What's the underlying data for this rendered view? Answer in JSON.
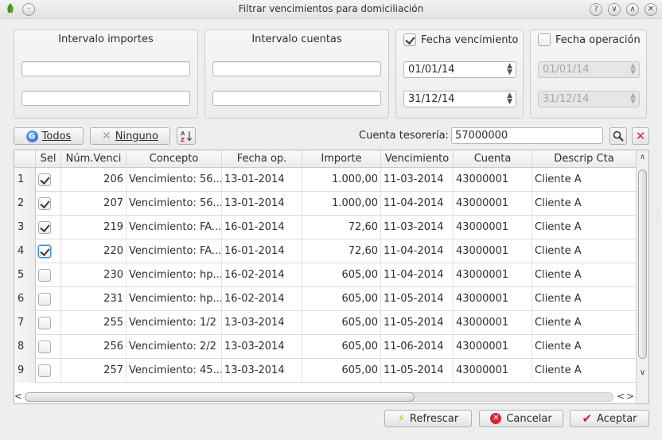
{
  "window": {
    "title": "Filtrar vencimientos para domiciliación",
    "buttons": [
      "?",
      "∨",
      "∧",
      "✕"
    ]
  },
  "filters": {
    "importes": {
      "title": "Intervalo importes",
      "from": "",
      "to": ""
    },
    "cuentas": {
      "title": "Intervalo cuentas",
      "from": "",
      "to": ""
    },
    "fecha_vencimiento": {
      "label": "Fecha vencimiento",
      "checked": true,
      "from": "01/01/14",
      "to": "31/12/14"
    },
    "fecha_operacion": {
      "label": "Fecha operación",
      "checked": false,
      "from": "01/01/14",
      "to": "31/12/14"
    }
  },
  "toolbar": {
    "todos_label": "Todos",
    "ninguno_label": "Ninguno",
    "cuenta_label": "Cuenta tesorería:",
    "cuenta_value": "57000000"
  },
  "table": {
    "columns": [
      "Sel",
      "Núm.Venci",
      "Concepto",
      "Fecha op.",
      "Importe",
      "Vencimiento",
      "Cuenta",
      "Descrip Cta"
    ],
    "rows": [
      {
        "n": "1",
        "sel": true,
        "num": "206",
        "concepto": "Vencimiento: 56...",
        "fecha": "13-01-2014",
        "importe": "1.000,00",
        "venc": "11-03-2014",
        "cuenta": "43000001",
        "desc": "Cliente A"
      },
      {
        "n": "2",
        "sel": true,
        "num": "207",
        "concepto": "Vencimiento: 56...",
        "fecha": "13-01-2014",
        "importe": "1.000,00",
        "venc": "11-04-2014",
        "cuenta": "43000001",
        "desc": "Cliente A"
      },
      {
        "n": "3",
        "sel": true,
        "num": "219",
        "concepto": "Vencimiento: FA...",
        "fecha": "16-01-2014",
        "importe": "72,60",
        "venc": "11-03-2014",
        "cuenta": "43000001",
        "desc": "Cliente A"
      },
      {
        "n": "4",
        "sel": true,
        "num": "220",
        "concepto": "Vencimiento: FA...",
        "fecha": "16-01-2014",
        "importe": "72,60",
        "venc": "11-04-2014",
        "cuenta": "43000001",
        "desc": "Cliente A"
      },
      {
        "n": "5",
        "sel": false,
        "num": "230",
        "concepto": "Vencimiento: hp...",
        "fecha": "16-02-2014",
        "importe": "605,00",
        "venc": "11-04-2014",
        "cuenta": "43000001",
        "desc": "Cliente A"
      },
      {
        "n": "6",
        "sel": false,
        "num": "231",
        "concepto": "Vencimiento: hp...",
        "fecha": "16-02-2014",
        "importe": "605,00",
        "venc": "11-05-2014",
        "cuenta": "43000001",
        "desc": "Cliente A"
      },
      {
        "n": "7",
        "sel": false,
        "num": "255",
        "concepto": "Vencimiento:  1/2",
        "fecha": "13-03-2014",
        "importe": "605,00",
        "venc": "11-05-2014",
        "cuenta": "43000001",
        "desc": "Cliente A"
      },
      {
        "n": "8",
        "sel": false,
        "num": "256",
        "concepto": "Vencimiento:  2/2",
        "fecha": "13-03-2014",
        "importe": "605,00",
        "venc": "11-06-2014",
        "cuenta": "43000001",
        "desc": "Cliente A"
      },
      {
        "n": "9",
        "sel": false,
        "num": "257",
        "concepto": "Vencimiento: 45...",
        "fecha": "13-03-2014",
        "importe": "605,00",
        "venc": "11-05-2014",
        "cuenta": "43000001",
        "desc": "Cliente A"
      }
    ]
  },
  "actions": {
    "refrescar": "Refrescar",
    "cancelar": "Cancelar",
    "aceptar": "Aceptar"
  }
}
